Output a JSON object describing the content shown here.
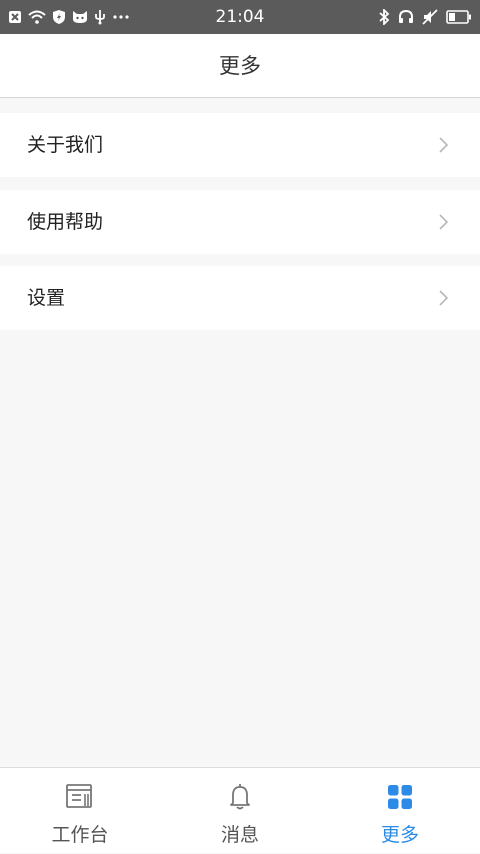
{
  "status_bar": {
    "time": "21:04",
    "left_icons": [
      "close-box-icon",
      "wifi-icon",
      "shield-icon",
      "cat-icon",
      "usb-icon",
      "more-dots-icon"
    ],
    "right_icons": [
      "bluetooth-icon",
      "headset-icon",
      "mute-icon",
      "battery-icon"
    ]
  },
  "header": {
    "title": "更多"
  },
  "menu": {
    "items": [
      {
        "label": "关于我们"
      },
      {
        "label": "使用帮助"
      },
      {
        "label": "设置"
      }
    ]
  },
  "tabbar": {
    "tabs": [
      {
        "label": "工作台",
        "icon": "workbench-icon",
        "active": false
      },
      {
        "label": "消息",
        "icon": "bell-icon",
        "active": false
      },
      {
        "label": "更多",
        "icon": "grid-icon",
        "active": true
      }
    ]
  },
  "colors": {
    "status_bar_bg": "#5b5b5b",
    "page_bg": "#f7f7f7",
    "accent": "#2b8be6",
    "chevron": "#b8b8b8"
  }
}
